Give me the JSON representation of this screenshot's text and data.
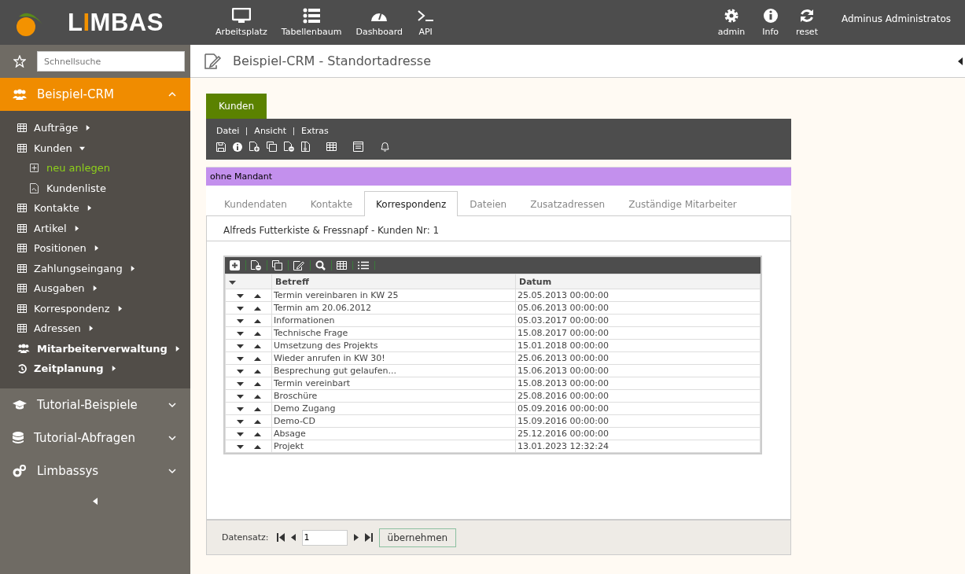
{
  "header": {
    "logo": {
      "before": "L",
      "highlight": "I",
      "after": "MBAS"
    },
    "nav": [
      {
        "label": "Arbeitsplatz",
        "kind": "monitor"
      },
      {
        "label": "Tabellenbaum",
        "kind": "list"
      },
      {
        "label": "Dashboard",
        "kind": "gauge"
      },
      {
        "label": "API",
        "kind": "terminal"
      }
    ],
    "tools": [
      {
        "label": "admin",
        "kind": "gear"
      },
      {
        "label": "Info",
        "kind": "info"
      },
      {
        "label": "reset",
        "kind": "refresh"
      }
    ],
    "user": "Adminus Administratos"
  },
  "sidebar": {
    "search": {
      "placeholder": "Schnellsuche"
    },
    "groups": [
      {
        "label": "Beispiel-CRM",
        "kind": "people",
        "expanded": true,
        "items": [
          {
            "label": "Aufträge",
            "kind": "table",
            "expanded": false
          },
          {
            "label": "Kunden",
            "kind": "table",
            "expanded": true,
            "children": [
              {
                "label": "neu anlegen",
                "kind": "add",
                "selected": true
              },
              {
                "label": "Kundenliste",
                "kind": "pdf",
                "selected": false
              }
            ]
          },
          {
            "label": "Kontakte",
            "kind": "table",
            "expanded": false
          },
          {
            "label": "Artikel",
            "kind": "table",
            "expanded": false
          },
          {
            "label": "Positionen",
            "kind": "table",
            "expanded": false
          },
          {
            "label": "Zahlungseingang",
            "kind": "table",
            "expanded": false
          },
          {
            "label": "Ausgaben",
            "kind": "table",
            "expanded": false
          },
          {
            "label": "Korrespondenz",
            "kind": "table",
            "expanded": false
          },
          {
            "label": "Adressen",
            "kind": "table",
            "expanded": false
          },
          {
            "label": "Mitarbeiterverwaltung",
            "kind": "people",
            "expanded": false
          },
          {
            "label": "Zeitplanung",
            "kind": "history",
            "expanded": false
          }
        ]
      },
      {
        "label": "Tutorial-Beispiele",
        "kind": "cap",
        "expanded": false
      },
      {
        "label": "Tutorial-Abfragen",
        "kind": "db",
        "expanded": false
      },
      {
        "label": "Limbassys",
        "kind": "gears",
        "expanded": false
      }
    ]
  },
  "page": {
    "title": "Beispiel-CRM - Standortadresse",
    "form_tab": "Kunden",
    "menu": [
      "Datei",
      "Ansicht",
      "Extras"
    ],
    "mandant": "ohne Mandant",
    "tabs": [
      {
        "label": "Kundendaten",
        "selected": false
      },
      {
        "label": "Kontakte",
        "selected": false
      },
      {
        "label": "Korrespondenz",
        "selected": true
      },
      {
        "label": "Dateien",
        "selected": false
      },
      {
        "label": "Zusatzadressen",
        "selected": false
      },
      {
        "label": "Zuständige Mitarbeiter",
        "selected": false
      }
    ],
    "record_title": "Alfreds Futterkiste & Fressnapf - Kunden Nr: 1",
    "table": {
      "columns": [
        "Betreff",
        "Datum"
      ],
      "rows": [
        [
          "Termin vereinbaren in KW 25",
          "25.05.2013 00:00:00"
        ],
        [
          "Termin am 20.06.2012",
          "05.06.2013 00:00:00"
        ],
        [
          "Informationen",
          "05.03.2017 00:00:00"
        ],
        [
          "Technische Frage",
          "15.08.2017 00:00:00"
        ],
        [
          "Umsetzung des Projekts",
          "15.01.2018 00:00:00"
        ],
        [
          "Wieder anrufen in KW 30!",
          "25.06.2013 00:00:00"
        ],
        [
          "Besprechung gut gelaufen...",
          "15.06.2013 00:00:00"
        ],
        [
          "Termin vereinbart",
          "15.08.2013 00:00:00"
        ],
        [
          "Broschüre",
          "25.08.2016 00:00:00"
        ],
        [
          "Demo Zugang",
          "05.09.2016 00:00:00"
        ],
        [
          "Demo-CD",
          "15.09.2016 00:00:00"
        ],
        [
          "Absage",
          "25.12.2016 00:00:00"
        ],
        [
          "Projekt",
          "13.01.2023 12:32:24"
        ]
      ]
    },
    "footer": {
      "label": "Datensatz:",
      "record": "1",
      "button": "übernehmen"
    }
  }
}
